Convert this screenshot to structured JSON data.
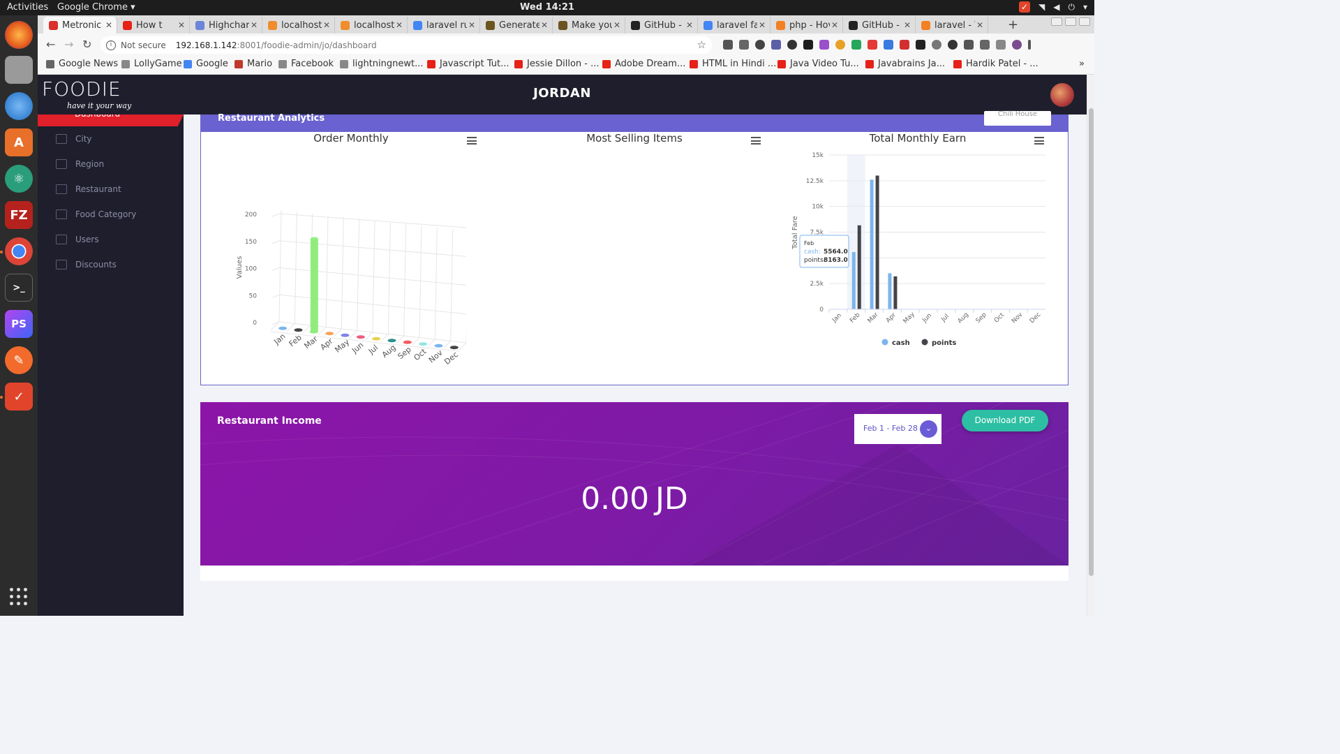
{
  "system": {
    "activities": "Activities",
    "app_menu": "Google Chrome",
    "clock": "Wed 14:21"
  },
  "browser": {
    "tabs": [
      {
        "title": "Metronic",
        "color": "#d9302b",
        "active": true
      },
      {
        "title": "How t",
        "color": "#e62117"
      },
      {
        "title": "Highchar",
        "color": "#6b85d8"
      },
      {
        "title": "localhost",
        "color": "#f08d2c"
      },
      {
        "title": "localhost",
        "color": "#f08d2c"
      },
      {
        "title": "laravel ru",
        "color": "#4285f4"
      },
      {
        "title": "Generate",
        "color": "#6b5420"
      },
      {
        "title": "Make you",
        "color": "#6b5420"
      },
      {
        "title": "GitHub - f",
        "color": "#222222"
      },
      {
        "title": "laravel fa",
        "color": "#4285f4"
      },
      {
        "title": "php - Hov",
        "color": "#f48024"
      },
      {
        "title": "GitHub - f",
        "color": "#222222"
      },
      {
        "title": "laravel - V",
        "color": "#f48024"
      }
    ],
    "security_label": "Not secure",
    "url_host": "192.168.1.142",
    "url_rest": ":8001/foodie-admin/jo/dashboard",
    "bookmarks": [
      {
        "label": "Google News",
        "color": "#666666"
      },
      {
        "label": "LollyGame",
        "color": "#888888"
      },
      {
        "label": "Google",
        "color": "#4285f4"
      },
      {
        "label": "Mario",
        "color": "#c0392b"
      },
      {
        "label": "Facebook",
        "color": "#888888"
      },
      {
        "label": "lightningnewt...",
        "color": "#888888"
      },
      {
        "label": "Javascript Tut...",
        "color": "#e62117"
      },
      {
        "label": "Jessie Dillon - ...",
        "color": "#e62117"
      },
      {
        "label": "Adobe Dream...",
        "color": "#e62117"
      },
      {
        "label": "HTML in Hindi ...",
        "color": "#e62117"
      },
      {
        "label": "Java Video Tu...",
        "color": "#e62117"
      },
      {
        "label": "Javabrains Ja...",
        "color": "#e62117"
      },
      {
        "label": "Hardik Patel - ...",
        "color": "#e62117"
      }
    ]
  },
  "app": {
    "logo_text": "FOODIE",
    "logo_tagline": "have it your way",
    "country": "JORDAN",
    "sidebar_active": "Dashboard",
    "sidebar": [
      {
        "label": "City"
      },
      {
        "label": "Region"
      },
      {
        "label": "Restaurant"
      },
      {
        "label": "Food Category"
      },
      {
        "label": "Users"
      },
      {
        "label": "Discounts"
      }
    ],
    "analytics_title": "Restaurant Analytics",
    "restaurant_select": "Chili House",
    "income": {
      "title": "Restaurant Income",
      "date_range": "Feb 1 - Feb 28",
      "download_label": "Download PDF",
      "amount": "0.00",
      "currency": "JD"
    }
  },
  "chart_data": [
    {
      "type": "bar",
      "title": "Order Monthly",
      "ylabel": "Values",
      "ylim": [
        0,
        200
      ],
      "yticks": [
        0,
        50,
        100,
        150,
        200
      ],
      "categories": [
        "Jan",
        "Feb",
        "Mar",
        "Apr",
        "May",
        "Jun",
        "Jul",
        "Aug",
        "Sep",
        "Oct",
        "Nov",
        "Dec"
      ],
      "values": [
        0,
        0,
        172,
        0,
        0,
        0,
        0,
        0,
        0,
        0,
        0,
        0
      ],
      "colors": [
        "#7cb5ec",
        "#434348",
        "#90ed7d",
        "#f7a35c",
        "#8085e9",
        "#f15c80",
        "#e4d354",
        "#2b908f",
        "#f45b5b",
        "#91e8e1",
        "#7cb5ec",
        "#434348"
      ],
      "style": "3d"
    },
    {
      "type": "pie",
      "title": "Most Selling Items",
      "values": []
    },
    {
      "type": "bar",
      "title": "Total Monthly Earn",
      "ylabel": "Total Fare",
      "ylim": [
        0,
        15000
      ],
      "yticks": [
        0,
        2500,
        5000,
        7500,
        10000,
        12500,
        15000
      ],
      "ytick_labels": [
        "0",
        "2.5k",
        "5k",
        "7.5k",
        "10k",
        "12.5k",
        "15k"
      ],
      "categories": [
        "Jan",
        "Feb",
        "Mar",
        "Apr",
        "May",
        "Jun",
        "Jul",
        "Aug",
        "Sep",
        "Oct",
        "Nov",
        "Dec"
      ],
      "series": [
        {
          "name": "cash",
          "color": "#7cb5ec",
          "values": [
            0,
            5564,
            12600,
            3500,
            0,
            0,
            0,
            0,
            0,
            0,
            0,
            0
          ]
        },
        {
          "name": "points",
          "color": "#434348",
          "values": [
            0,
            8163,
            13000,
            3200,
            0,
            0,
            0,
            0,
            0,
            0,
            0,
            0
          ]
        }
      ],
      "tooltip": {
        "category": "Feb",
        "cash_label": "cash:",
        "cash_value": "5564.0",
        "points_label": "points:",
        "points_value": "8163.0"
      },
      "legend": "bottom-center"
    }
  ]
}
